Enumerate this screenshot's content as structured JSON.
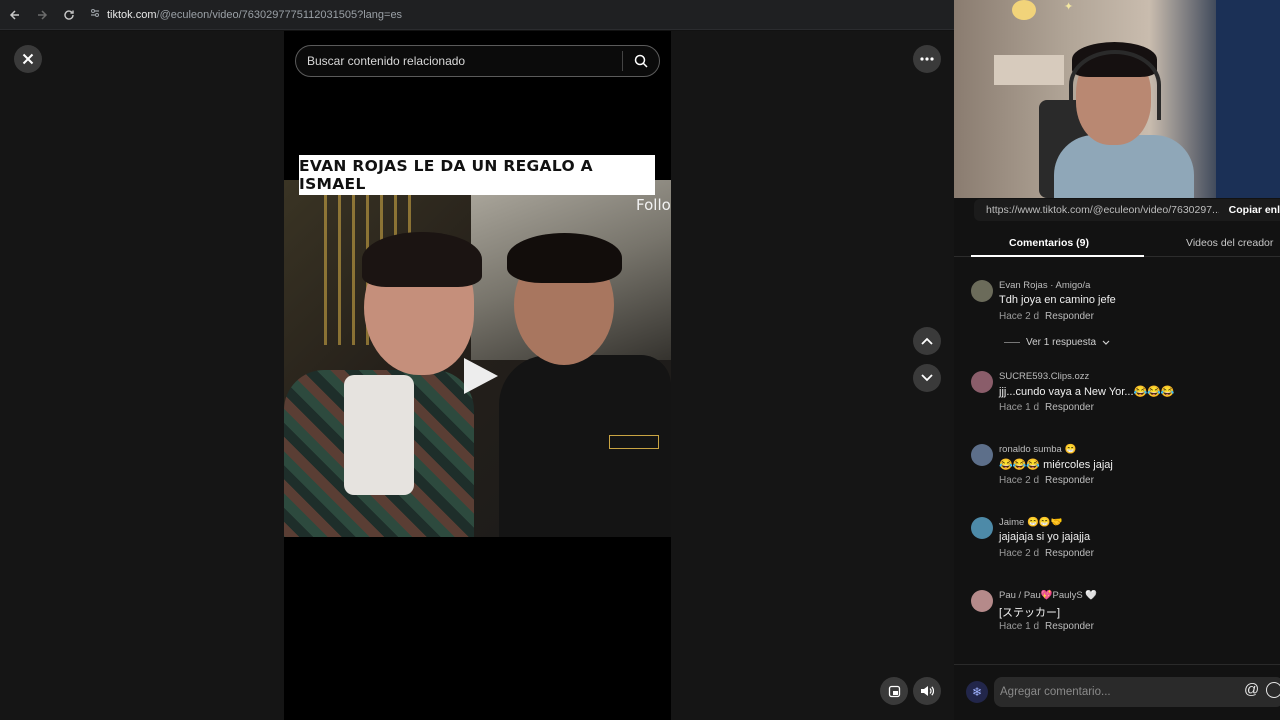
{
  "browser": {
    "url_host": "tiktok.com",
    "url_path": "/@eculeon/video/7630297775112031505?lang=es"
  },
  "search": {
    "placeholder": "Buscar contenido relacionado"
  },
  "video": {
    "caption_title": "EVAN ROJAS LE DA UN REGALO A ISMAEL",
    "overlay_text": "Follo"
  },
  "share": {
    "url": "https://www.tiktok.com/@eculeon/video/7630297...",
    "copy_label": "Copiar enl"
  },
  "tabs": {
    "comments": "Comentarios (9)",
    "creator_videos": "Videos del creador"
  },
  "comments": [
    {
      "user": "Evan Rojas · Amigo/a",
      "text": "Tdh joya en camino jefe",
      "time": "Hace 2 d",
      "reply": "Responder",
      "avatar_color": "#6b6b5a"
    },
    {
      "user": "SUCRE593.Clips.ozz",
      "text": "jjj...cundo vaya a New Yor...😂😂😂",
      "time": "Hace 1 d",
      "reply": "Responder",
      "avatar_color": "#8a5d6a"
    },
    {
      "user": "ronaldo sumba 😁",
      "text": "😂😂😂 miércoles jajaj",
      "time": "Hace 2 d",
      "reply": "Responder",
      "avatar_color": "#5d6f8a"
    },
    {
      "user": "Jaime 😁😁🤝",
      "text": "jajajaja si yo jajajja",
      "time": "Hace 2 d",
      "reply": "Responder",
      "avatar_color": "#4d8aa8"
    },
    {
      "user": "Pau / Pau💖PaulyS 🤍",
      "text": "[ステッカー]",
      "time": "Hace 1 d",
      "reply": "Responder",
      "avatar_color": "#b58a8a"
    }
  ],
  "view_replies": "Ver 1 respuesta",
  "comment_input": {
    "placeholder": "Agregar comentario..."
  },
  "icons": [
    "back-icon",
    "forward-icon",
    "reload-icon",
    "site-settings-icon",
    "close-icon",
    "more-icon",
    "search-icon",
    "play-icon",
    "chevron-up-icon",
    "chevron-down-icon",
    "mini-player-icon",
    "volume-icon",
    "at-icon",
    "emoji-icon"
  ]
}
